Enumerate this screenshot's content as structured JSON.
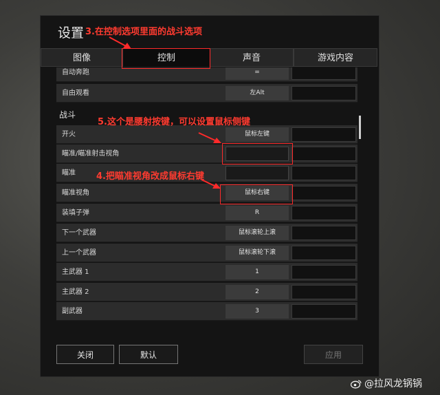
{
  "window": {
    "title": "设置"
  },
  "tabs": [
    {
      "label": "图像",
      "active": false
    },
    {
      "label": "控制",
      "active": true
    },
    {
      "label": "声音",
      "active": false
    },
    {
      "label": "游戏内容",
      "active": false
    }
  ],
  "rows_top": [
    {
      "label": "自动奔跑",
      "key": "="
    },
    {
      "label": "自由观看",
      "key": "左Alt"
    }
  ],
  "section_combat": "战斗",
  "rows_combat": [
    {
      "label": "开火",
      "key": "鼠标左键"
    },
    {
      "label": "瞄准/瞄准射击视角",
      "key": ""
    },
    {
      "label": "瞄准",
      "key": ""
    },
    {
      "label": "瞄准视角",
      "key": "鼠标右键"
    },
    {
      "label": "装填子弹",
      "key": "R"
    },
    {
      "label": "下一个武器",
      "key": "鼠标滚轮上滚"
    },
    {
      "label": "上一个武器",
      "key": "鼠标滚轮下滚"
    },
    {
      "label": "主武器 1",
      "key": "1"
    },
    {
      "label": "主武器 2",
      "key": "2"
    },
    {
      "label": "副武器",
      "key": "3"
    }
  ],
  "footer": {
    "close": "关闭",
    "default": "默认",
    "apply": "应用"
  },
  "annotations": {
    "step3": "3.在控制选项里面的战斗选项",
    "step5": "5.这个是腰射按键，可以设置鼠标侧键",
    "step4": "4.把瞄准视角改成鼠标右键"
  },
  "watermark": "@拉风龙锅锅",
  "colors": {
    "annotation": "#ff3b30",
    "panel": "#141414",
    "row": "#2c2c2c"
  }
}
